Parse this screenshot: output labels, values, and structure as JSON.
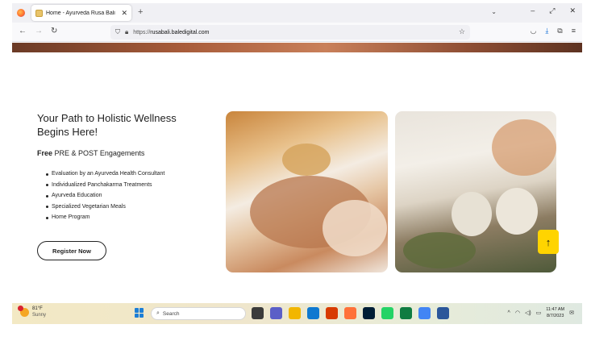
{
  "browser": {
    "tab_title": "Home - Ayurveda Rusa Bali",
    "new_tab_label": "+",
    "close_label": "✕",
    "url_prefix": "https://",
    "url_domain": "rusabali.baledigital.com",
    "window_controls": [
      "–",
      "⤢",
      "✕"
    ]
  },
  "page": {
    "headline_line1": "Your Path to Holistic Wellness",
    "headline_line2": "Begins Here!",
    "subhead_bold": "Free",
    "subhead_rest": " PRE & POST Engagements",
    "features": [
      "Evaluation by an Ayurveda Health Consultant",
      "Individualized Panchakarma Treatments",
      "Ayurveda Education",
      "Specialized Vegetarian Meals",
      "Home Program"
    ],
    "register_label": "Register Now",
    "scroll_top_label": "↑"
  },
  "taskbar": {
    "weather_temp": "81°F",
    "weather_condition": "Sunny",
    "search_placeholder": "Search",
    "time": "11:47 AM",
    "date": "8/7/2023",
    "app_colors": [
      "#3b3b3b",
      "#5b5fc7",
      "#f2b600",
      "#0f79d0",
      "#d83b01",
      "#ff7139",
      "#001e36",
      "#25d366",
      "#107c41",
      "#4285f4",
      "#2b579a"
    ]
  },
  "colors": {
    "accent_yellow": "#ffd400",
    "tab_bg": "#f0f0f4"
  }
}
